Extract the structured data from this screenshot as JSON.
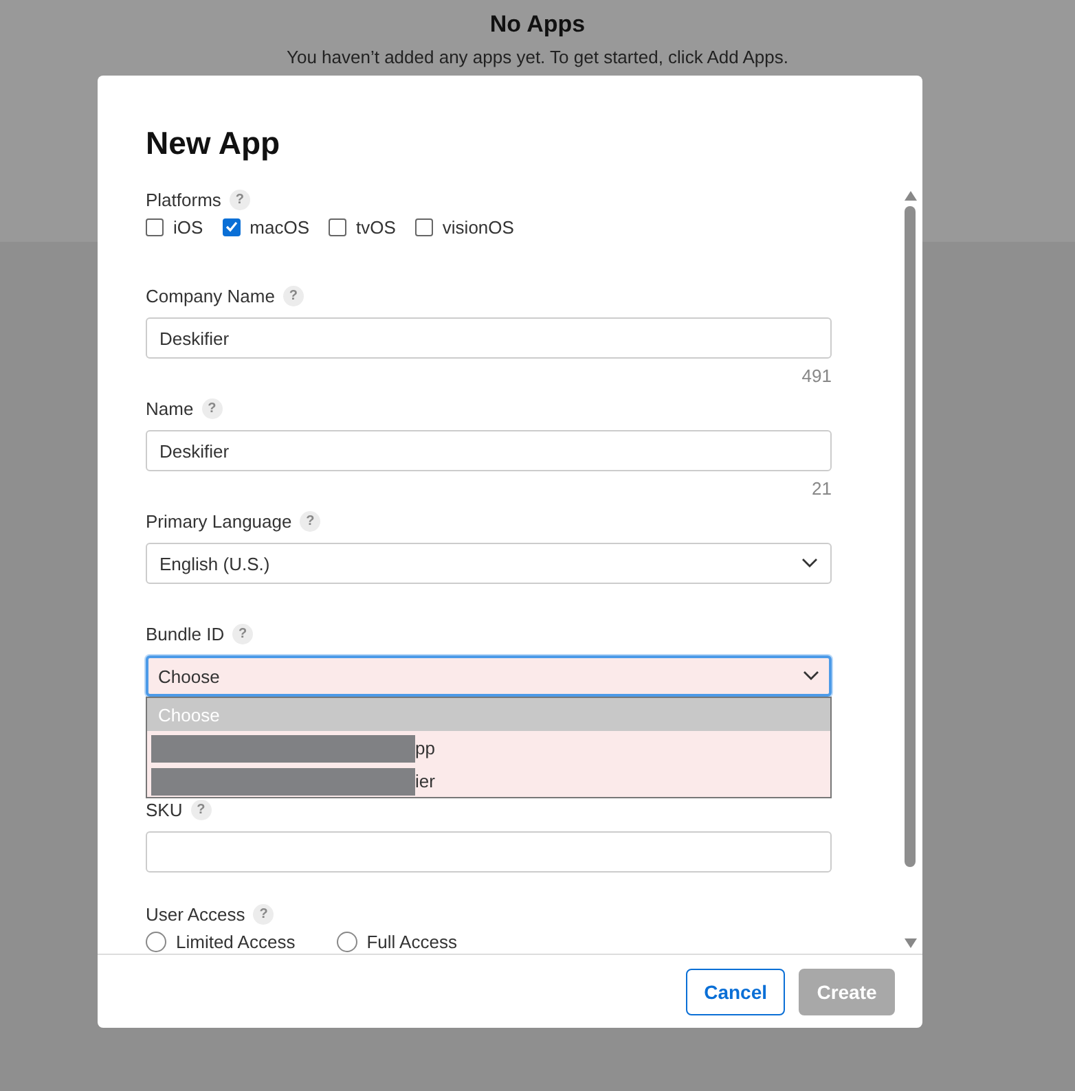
{
  "background": {
    "title": "No Apps",
    "message": "You haven’t added any apps yet. To get started, click Add Apps."
  },
  "dialog": {
    "title": "New App",
    "fields": [
      {
        "kind": "checkboxes",
        "label": "Platforms",
        "help": "?",
        "options": [
          {
            "label": "iOS",
            "checked": false
          },
          {
            "label": "macOS",
            "checked": true
          },
          {
            "label": "tvOS",
            "checked": false
          },
          {
            "label": "visionOS",
            "checked": false
          }
        ]
      },
      {
        "kind": "text",
        "label": "Company Name",
        "help": "?",
        "value": "Deskifier",
        "counter": "491"
      },
      {
        "kind": "text",
        "label": "Name",
        "help": "?",
        "value": "Deskifier",
        "counter": "21"
      },
      {
        "kind": "select",
        "label": "Primary Language",
        "help": "?",
        "value": "English (U.S.)",
        "focused": false,
        "invalid": false
      },
      {
        "kind": "select",
        "label": "Bundle ID",
        "help": "?",
        "value": "Choose",
        "focused": true,
        "invalid": true,
        "expanded": true,
        "options": [
          {
            "label": "Choose",
            "selected": true,
            "redacted": false
          },
          {
            "label": "pp",
            "selected": false,
            "redacted": true
          },
          {
            "label": "ier",
            "selected": false,
            "redacted": true
          }
        ]
      },
      {
        "kind": "text",
        "label": "SKU",
        "help": "?"
      },
      {
        "kind": "radios",
        "label": "User Access",
        "help": "?",
        "options": [
          {
            "label": "Limited Access",
            "selected": false
          },
          {
            "label": "Full Access",
            "selected": false
          }
        ]
      }
    ],
    "buttons": [
      {
        "label": "Cancel",
        "disabled": false
      },
      {
        "label": "Create",
        "disabled": true
      }
    ]
  }
}
